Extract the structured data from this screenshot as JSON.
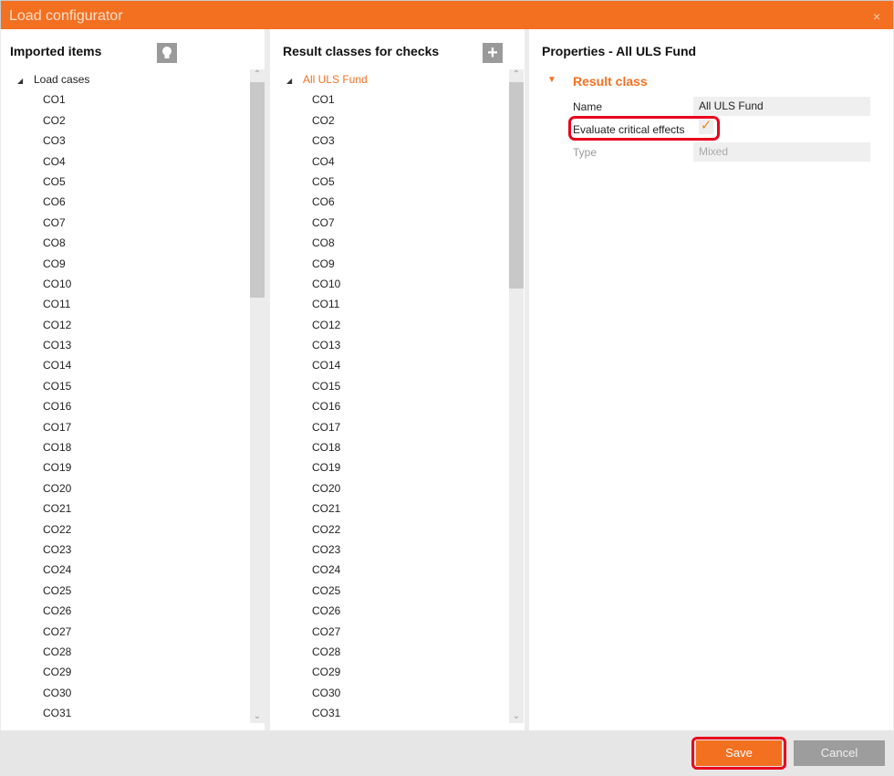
{
  "window": {
    "title": "Load configurator",
    "close_icon": "×"
  },
  "imported": {
    "title": "Imported items",
    "hint_icon": "lightbulb-icon",
    "root": "Load cases",
    "items": [
      "CO1",
      "CO2",
      "CO3",
      "CO4",
      "CO5",
      "CO6",
      "CO7",
      "CO8",
      "CO9",
      "CO10",
      "CO11",
      "CO12",
      "CO13",
      "CO14",
      "CO15",
      "CO16",
      "CO17",
      "CO18",
      "CO19",
      "CO20",
      "CO21",
      "CO22",
      "CO23",
      "CO24",
      "CO25",
      "CO26",
      "CO27",
      "CO28",
      "CO29",
      "CO30",
      "CO31"
    ]
  },
  "result_classes": {
    "title": "Result classes for checks",
    "add_icon": "+",
    "root": "All ULS Fund",
    "items": [
      "CO1",
      "CO2",
      "CO3",
      "CO4",
      "CO5",
      "CO6",
      "CO7",
      "CO8",
      "CO9",
      "CO10",
      "CO11",
      "CO12",
      "CO13",
      "CO14",
      "CO15",
      "CO16",
      "CO17",
      "CO18",
      "CO19",
      "CO20",
      "CO21",
      "CO22",
      "CO23",
      "CO24",
      "CO25",
      "CO26",
      "CO27",
      "CO28",
      "CO29",
      "CO30",
      "CO31"
    ]
  },
  "properties": {
    "title": "Properties - All ULS Fund",
    "section": "Result class",
    "name_label": "Name",
    "name_value": "All ULS Fund",
    "evaluate_label": "Evaluate critical effects",
    "evaluate_checked": true,
    "check_glyph": "✓",
    "type_label": "Type",
    "type_value": "Mixed"
  },
  "footer": {
    "save": "Save",
    "cancel": "Cancel"
  },
  "colors": {
    "accent": "#f37021",
    "highlight": "#e8001c"
  }
}
